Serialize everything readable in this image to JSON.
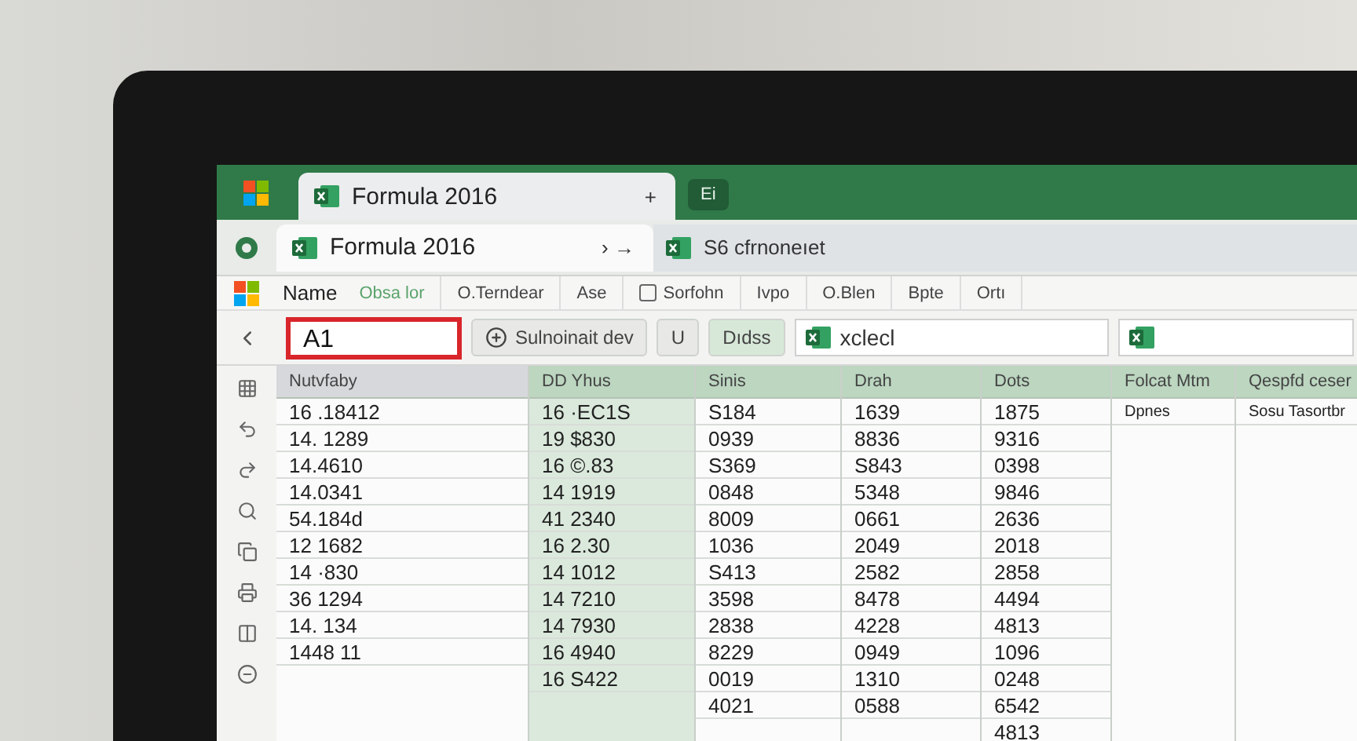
{
  "title_bar": {
    "tab": {
      "label": "Formula 2016",
      "action": "+"
    },
    "button": "Ei"
  },
  "tab_row": {
    "tab": {
      "label": "Formula 2016",
      "action": "› →"
    },
    "document": "S6 cfrnoneıet"
  },
  "ribbon": {
    "name_label": "Name",
    "items": [
      {
        "label": "Obsa lor",
        "kind": "accent"
      },
      {
        "label": "O.Terndear",
        "kind": "plain"
      },
      {
        "label": "Ase",
        "kind": "plain"
      },
      {
        "label": "Sorfohn",
        "kind": "boxed"
      },
      {
        "label": "Ivpo",
        "kind": "plain"
      },
      {
        "label": "O.Blen",
        "kind": "plain"
      },
      {
        "label": "Bpte",
        "kind": "plain"
      },
      {
        "label": "Ortı",
        "kind": "plain"
      }
    ]
  },
  "formula_bar": {
    "name_box": {
      "value": "A1",
      "selected": true
    },
    "buttons": [
      {
        "label": "Sulnoinait dev",
        "kind": "icon"
      },
      {
        "label": "U",
        "kind": "plain"
      },
      {
        "label": "Dıdss",
        "kind": "accent"
      }
    ],
    "field": "xclecl"
  },
  "grid": {
    "columns": [
      {
        "header": "Nutvfaby",
        "highlighted": false,
        "cells": [
          "16 .18412",
          "14. 1289",
          "14.4610",
          "14.0341",
          "54.184d",
          "12 1682",
          "14 ·830",
          "36 1294",
          "14. 134",
          "1448 11"
        ]
      },
      {
        "header": "DD Yhus",
        "highlighted": true,
        "cells": [
          "16 ·EC1S",
          "19 $830",
          "16 ©.83",
          "14 1919",
          "41 2340",
          "16 2.30",
          "14 1012",
          "14 7210",
          "14 7930",
          "16 4940",
          "16 S422"
        ]
      },
      {
        "header": "Sinis",
        "highlighted": false,
        "cells": [
          "S184",
          "0939",
          "S369",
          "0848",
          "8009",
          "1036",
          "S413",
          "3598",
          "2838",
          "8229",
          "0019",
          "4021"
        ]
      },
      {
        "header": "Drah",
        "highlighted": false,
        "cells": [
          "1639",
          "8836",
          "S843",
          "5348",
          "0661",
          "2049",
          "2582",
          "8478",
          "4228",
          "0949",
          "1310",
          "0588"
        ]
      },
      {
        "header": "Dots",
        "highlighted": false,
        "cells": [
          "1875",
          "9316",
          "0398",
          "9846",
          "2636",
          "2018",
          "2858",
          "4494",
          "4813",
          "1096",
          "0248",
          "6542",
          "4813"
        ]
      },
      {
        "header": "Folcat Mtm",
        "highlighted": false,
        "cells": [
          "Dpnes"
        ]
      },
      {
        "header": "Qespfd ceser",
        "highlighted": false,
        "cells": [
          "Sosu Tasortbr"
        ]
      }
    ]
  }
}
